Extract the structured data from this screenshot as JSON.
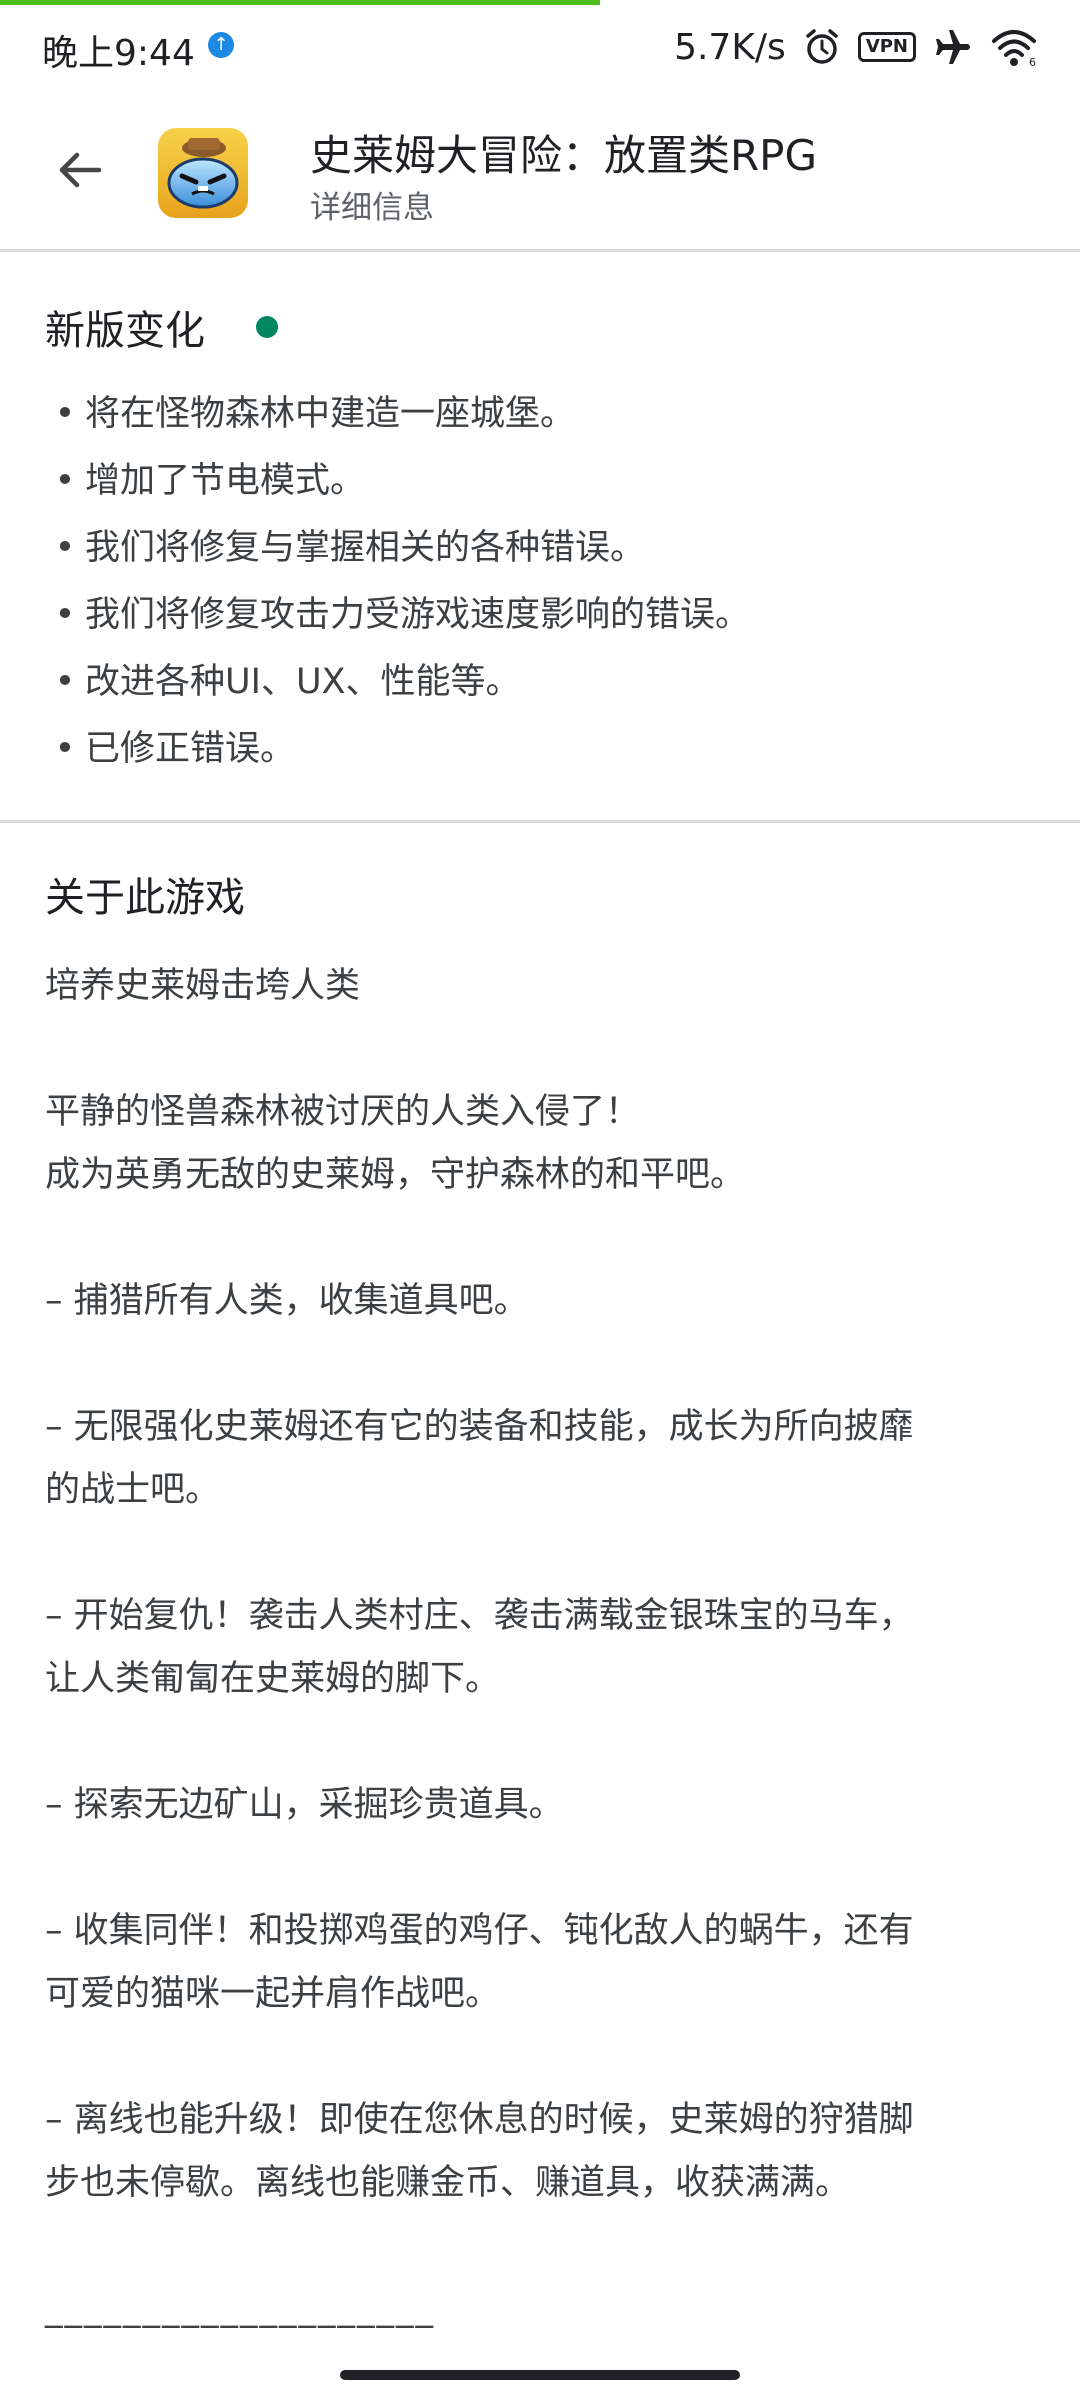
{
  "status_bar": {
    "time": "晚上9:44",
    "net_speed": "5.7K/s",
    "vpn_label": "VPN"
  },
  "header": {
    "title": "史莱姆大冒险：放置类RPG",
    "subtitle": "详细信息"
  },
  "whats_new": {
    "title": "新版变化",
    "bullet": "•",
    "items": [
      "将在怪物森林中建造一座城堡。",
      "增加了节电模式。",
      "我们将修复与掌握相关的各种错误。",
      "我们将修复攻击力受游戏速度影响的错误。",
      "改进各种UI、UX、性能等。",
      "已修正错误。"
    ]
  },
  "about": {
    "title": "关于此游戏",
    "lines": [
      "培养史莱姆击垮人类",
      "",
      "平静的怪兽森林被讨厌的人类入侵了！",
      "成为英勇无敌的史莱姆，守护森林的和平吧。",
      "",
      "– 捕猎所有人类，收集道具吧。",
      "",
      "– 无限强化史莱姆还有它的装备和技能，成长为所向披靡",
      "的战士吧。",
      "",
      "– 开始复仇！袭击人类村庄、袭击满载金银珠宝的马车，",
      "让人类匍匐在史莱姆的脚下。",
      "",
      "– 探索无边矿山，采掘珍贵道具。",
      "",
      "– 收集同伴！和投掷鸡蛋的鸡仔、钝化敌人的蜗牛，还有",
      "可爱的猫咪一起并肩作战吧。",
      "",
      "– 离线也能升级！即使在您休息的时候，史莱姆的狩猎脚",
      "步也未停歇。离线也能赚金币、赚道具，收获满满。",
      ""
    ],
    "separator": "____________________"
  },
  "colors": {
    "progress": "#4cc021",
    "new_dot": "#01875f",
    "divider": "#dadce0"
  },
  "icons": [
    "back-arrow-icon",
    "app-icon",
    "alarm-icon",
    "airplane-icon",
    "wifi-icon"
  ]
}
